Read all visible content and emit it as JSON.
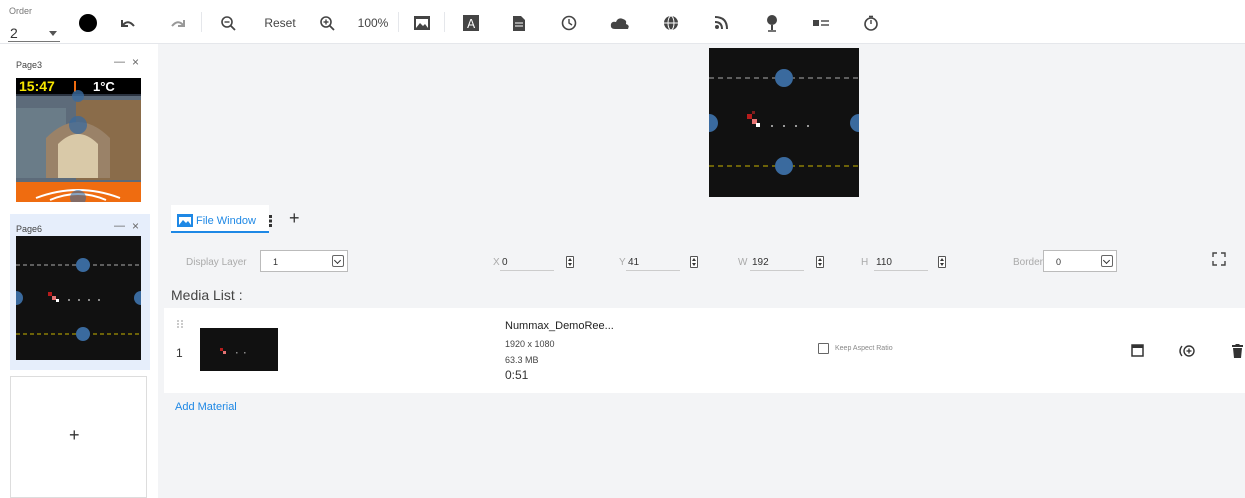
{
  "toolbar": {
    "order_label": "Order",
    "order_value": "2",
    "reset_label": "Reset",
    "zoom_level": "100%"
  },
  "pages": [
    {
      "title": "Page3",
      "clock_time": "15:47",
      "temperature": "1°C"
    },
    {
      "title": "Page6"
    }
  ],
  "page_controls": {
    "minimize": "—",
    "close": "×"
  },
  "add_page_label": "+",
  "tabs": {
    "active_label": "File Window",
    "add_label": "+"
  },
  "props": {
    "display_layer_label": "Display Layer",
    "display_layer_value": "1",
    "x_label": "X",
    "x_value": "0",
    "y_label": "Y",
    "y_value": "41",
    "w_label": "W",
    "w_value": "192",
    "h_label": "H",
    "h_value": "110",
    "border_label": "Border",
    "border_value": "0"
  },
  "media_list": {
    "title": "Media List :",
    "items": [
      {
        "index": "1",
        "name": "Nummax_DemoRee...",
        "resolution": "1920 x 1080",
        "size": "63.3 MB",
        "duration": "0:51",
        "keep_aspect_label": "Keep Aspect Ratio"
      }
    ]
  },
  "add_material_label": "Add Material",
  "colors": {
    "accent": "#1e88e5",
    "handle": "#3a6a9e",
    "guide": "#c8b400"
  }
}
